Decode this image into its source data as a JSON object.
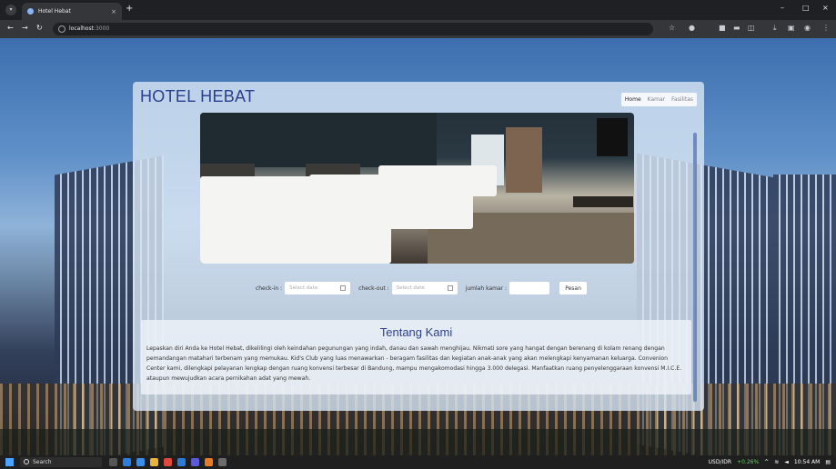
{
  "browser": {
    "tab_title": "Hotel Hebat",
    "tab_close": "×",
    "new_tab": "+",
    "url_host": "localhost",
    "url_port": ":3000",
    "window_controls": [
      "–",
      "□",
      "×"
    ]
  },
  "header": {
    "brand": "HOTEL HEBAT",
    "nav": [
      "Home",
      "Kamar",
      "Fasilitas"
    ]
  },
  "booking": {
    "checkin_label": "check-in :",
    "checkin_placeholder": "Select date",
    "checkout_label": "check-out :",
    "checkout_placeholder": "Select date",
    "rooms_label": "jumlah kamar :",
    "submit_label": "Pesan"
  },
  "about": {
    "title": "Tentang Kami",
    "body": "Lepaskan diri Anda ke Hotel Hebat, dikelilingi oleh keindahan pegunungan yang indah, danau dan sawah menghijau. Nikmati sore yang hangat dengan berenang di kolam renang dengan pemandangan matahari terbenam yang memukau. Kid's Club yang luas menawarkan - beragam fasilitas dan kegiatan anak-anak yang akan melengkapi kenyamanan keluarga. Convenion Center kami, dilengkapi pelayanan lengkap dengan ruang konvensi terbesar di Bandung, mampu mengakomodasi hingga 3.000 delegasi. Manfaatkan ruang penyelenggaraan konvensi M.I.C.E. ataupun mewujudkan acara pernikahan adat yang mewah."
  },
  "taskbar": {
    "search_placeholder": "Search",
    "currency": "USD/IDR",
    "currency_change": "+0.26%",
    "time": "10:54 AM"
  },
  "colors": {
    "brand": "#2a3f8f",
    "card": "#d7e4f3",
    "chrome": "#35363a"
  }
}
